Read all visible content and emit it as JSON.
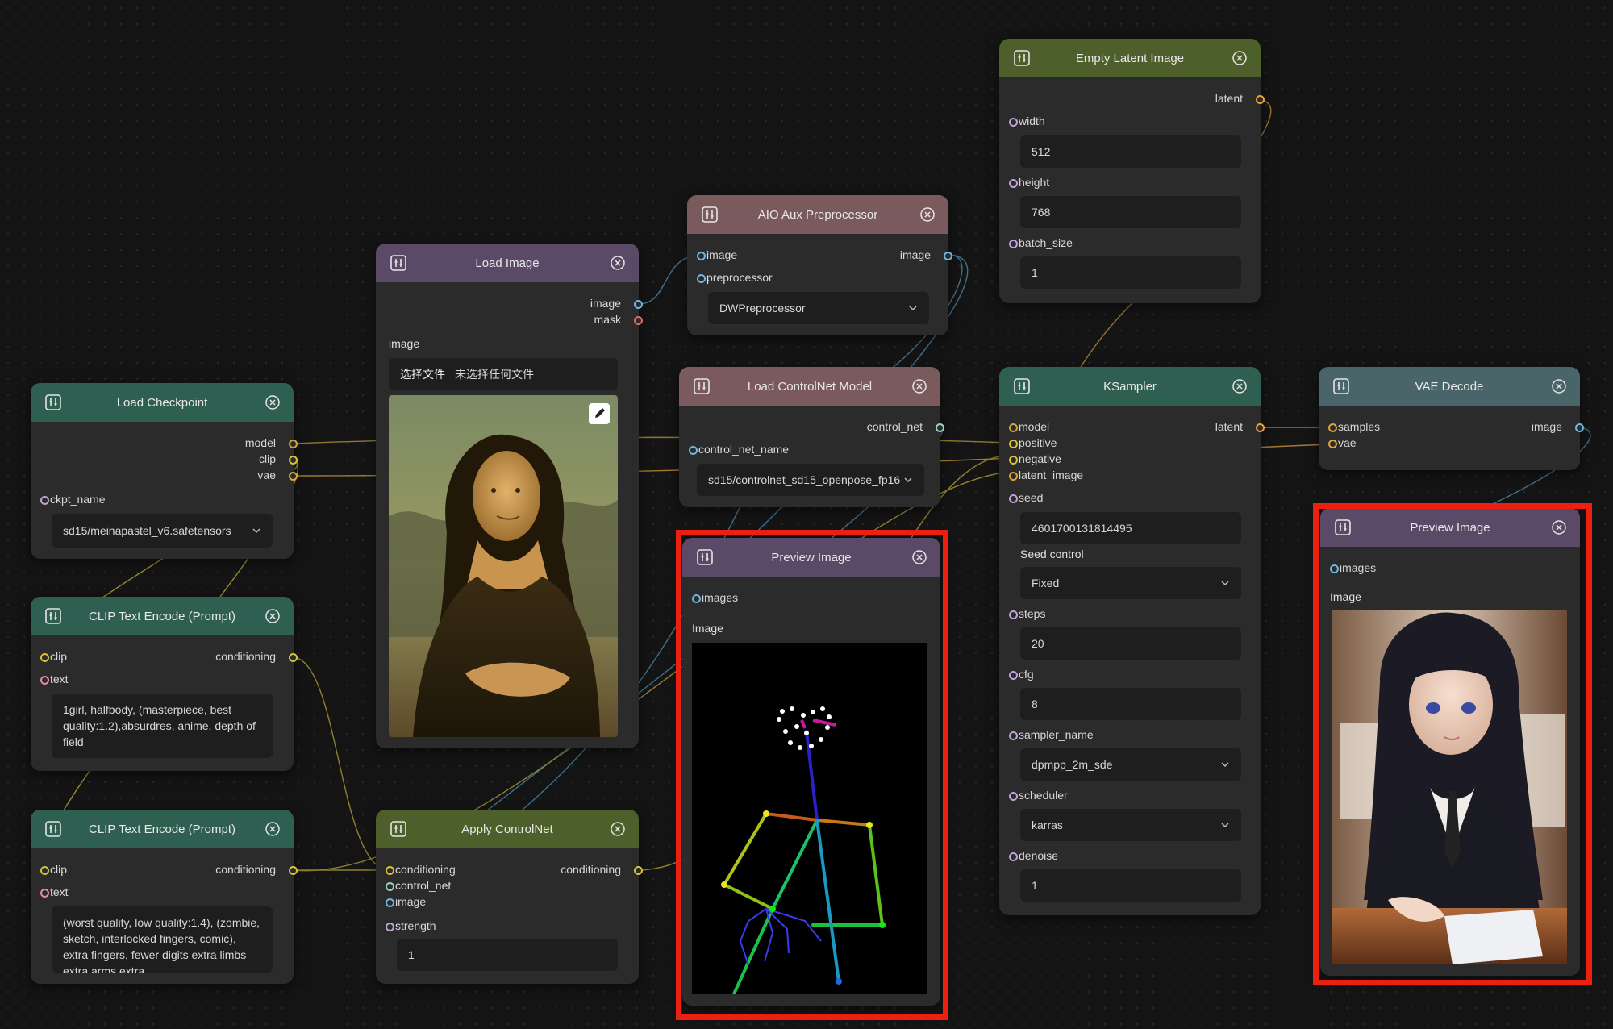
{
  "colors": {
    "canvas": "#141414",
    "node_body": "#2b2b2b",
    "field": "#1e1e1e",
    "highlight": "#ec1f10",
    "socket_model": "#c7a93b",
    "socket_clip": "#d4c23c",
    "socket_vae": "#e0a63c",
    "socket_image": "#6cb6e0",
    "socket_mask": "#e06b6b",
    "socket_latent": "#e2a03b",
    "socket_string": "#bfa3d6"
  },
  "load_checkpoint": {
    "title": "Load Checkpoint",
    "out_model": "model",
    "out_clip": "clip",
    "out_vae": "vae",
    "ckpt_label": "ckpt_name",
    "ckpt_value": "sd15/meinapastel_v6.safetensors"
  },
  "clip_pos": {
    "title": "CLIP Text Encode (Prompt)",
    "in_clip": "clip",
    "out_conditioning": "conditioning",
    "text_label": "text",
    "text_value": "1girl, halfbody, (masterpiece, best quality:1.2),absurdres, anime, depth of field"
  },
  "clip_neg": {
    "title": "CLIP Text Encode (Prompt)",
    "in_clip": "clip",
    "out_conditioning": "conditioning",
    "text_label": "text",
    "text_value": "(worst quality, low quality:1.4), (zombie, sketch, interlocked fingers, comic), extra fingers, fewer digits extra limbs extra arms extra"
  },
  "load_image": {
    "title": "Load Image",
    "out_image": "image",
    "out_mask": "mask",
    "image_label": "image",
    "choose_file": "选择文件",
    "no_file": "未选择任何文件"
  },
  "apply_controlnet": {
    "title": "Apply ControlNet",
    "in_conditioning": "conditioning",
    "in_control_net": "control_net",
    "in_image": "image",
    "out_conditioning": "conditioning",
    "strength_label": "strength",
    "strength_value": "1"
  },
  "aio_aux": {
    "title": "AIO Aux Preprocessor",
    "in_image": "image",
    "out_image": "image",
    "pre_label": "preprocessor",
    "pre_value": "DWPreprocessor"
  },
  "load_controlnet": {
    "title": "Load ControlNet Model",
    "out_control_net": "control_net",
    "name_label": "control_net_name",
    "name_value": "sd15/controlnet_sd15_openpose_fp16"
  },
  "preview_pose": {
    "title": "Preview Image",
    "in_images": "images",
    "image_heading": "Image"
  },
  "empty_latent": {
    "title": "Empty Latent Image",
    "out_latent": "latent",
    "width_label": "width",
    "width_value": "512",
    "height_label": "height",
    "height_value": "768",
    "batch_label": "batch_size",
    "batch_value": "1"
  },
  "ksampler": {
    "title": "KSampler",
    "in_model": "model",
    "in_positive": "positive",
    "in_negative": "negative",
    "in_latent": "latent_image",
    "out_latent": "latent",
    "seed_label": "seed",
    "seed_value": "4601700131814495",
    "seed_control_label": "Seed control",
    "seed_control_value": "Fixed",
    "steps_label": "steps",
    "steps_value": "20",
    "cfg_label": "cfg",
    "cfg_value": "8",
    "sampler_label": "sampler_name",
    "sampler_value": "dpmpp_2m_sde",
    "scheduler_label": "scheduler",
    "scheduler_value": "karras",
    "denoise_label": "denoise",
    "denoise_value": "1"
  },
  "vae_decode": {
    "title": "VAE Decode",
    "in_samples": "samples",
    "in_vae": "vae",
    "out_image": "image"
  },
  "preview_final": {
    "title": "Preview Image",
    "in_images": "images",
    "image_heading": "Image"
  }
}
